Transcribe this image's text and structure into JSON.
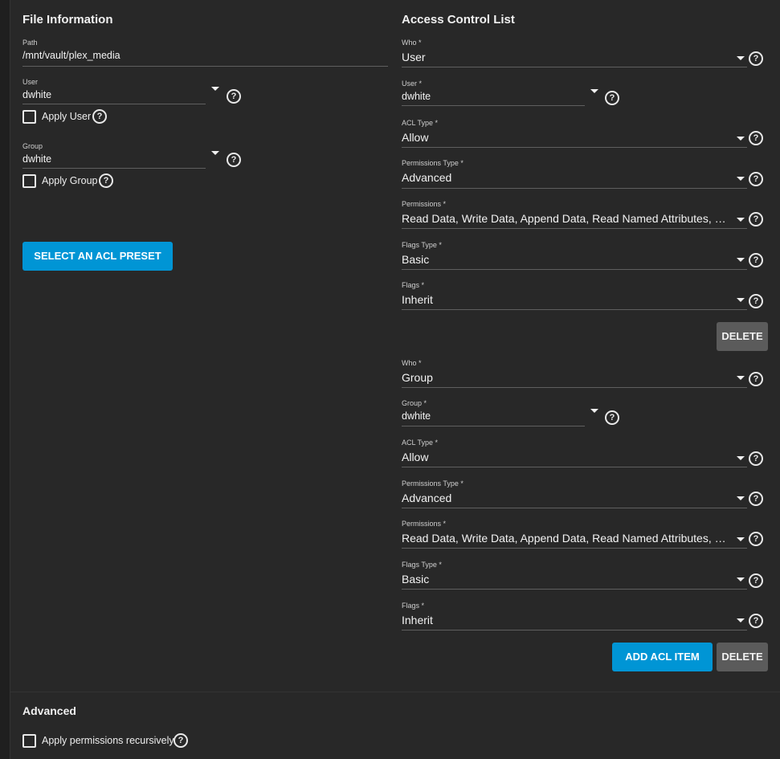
{
  "file_info": {
    "title": "File Information",
    "path_label": "Path",
    "path_value": "/mnt/vault/plex_media",
    "user_label": "User",
    "user_value": "dwhite",
    "apply_user_label": "Apply User",
    "group_label": "Group",
    "group_value": "dwhite",
    "apply_group_label": "Apply Group",
    "select_preset_label": "SELECT AN ACL PRESET"
  },
  "acl": {
    "title": "Access Control List",
    "items": [
      {
        "who_label": "Who *",
        "who_value": "User",
        "entity_label": "User *",
        "entity_value": "dwhite",
        "acl_type_label": "ACL Type *",
        "acl_type_value": "Allow",
        "perm_type_label": "Permissions Type *",
        "perm_type_value": "Advanced",
        "perms_label": "Permissions *",
        "perms_value": "Read Data, Write Data, Append Data, Read Named Attributes, Wri...",
        "flags_type_label": "Flags Type *",
        "flags_type_value": "Basic",
        "flags_label": "Flags *",
        "flags_value": "Inherit",
        "delete_label": "DELETE"
      },
      {
        "who_label": "Who *",
        "who_value": "Group",
        "entity_label": "Group *",
        "entity_value": "dwhite",
        "acl_type_label": "ACL Type *",
        "acl_type_value": "Allow",
        "perm_type_label": "Permissions Type *",
        "perm_type_value": "Advanced",
        "perms_label": "Permissions *",
        "perms_value": "Read Data, Write Data, Append Data, Read Named Attributes, Wri...",
        "flags_type_label": "Flags Type *",
        "flags_type_value": "Basic",
        "flags_label": "Flags *",
        "flags_value": "Inherit",
        "delete_label": "DELETE"
      }
    ],
    "add_label": "ADD ACL ITEM"
  },
  "advanced": {
    "title": "Advanced",
    "recursive_label": "Apply permissions recursively"
  },
  "help_glyph": "?",
  "colors": {
    "accent": "#0095d5",
    "background": "#282828",
    "button_grey": "#5b5b5b"
  }
}
